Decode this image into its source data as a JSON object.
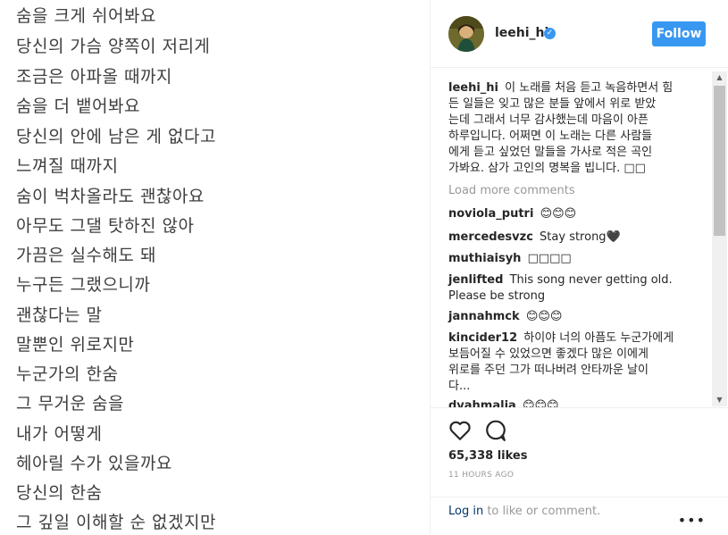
{
  "image": {
    "lyrics": [
      "숨을 크게 쉬어봐요",
      "당신의 가슴 양쪽이 저리게",
      "조금은 아파올 때까지",
      "숨을 더 뱉어봐요",
      "당신의 안에 남은 게 없다고",
      "느껴질 때까지",
      "숨이 벅차올라도 괜찮아요",
      "아무도 그댈 탓하진 않아",
      "가끔은 실수해도 돼",
      "누구든 그랬으니까",
      "괜찮다는 말",
      "말뿐인 위로지만",
      "누군가의 한숨",
      "그 무거운 숨을",
      "내가 어떻게",
      "헤아릴 수가 있을까요",
      "당신의 한숨",
      "그 깊일 이해할 순 없겠지만"
    ]
  },
  "header": {
    "username": "leehi_hi",
    "follow_label": "Follow",
    "colors": {
      "accent": "#3897f0"
    }
  },
  "caption": {
    "user": "leehi_hi",
    "lines": [
      "이 노래를 처음 듣고 녹음하면서 힘",
      "든 일들은 잊고 많은 분들 앞에서 위로 받았",
      "는데 그래서 너무 감사했는데 마음이 아픈",
      "하루입니다. 어쩌면 이 노래는 다른 사람들",
      "에게 듣고 싶었던 말들을 가사로 적은 곡인",
      "가봐요. 삼가 고인의 명복을 빕니다. □□"
    ]
  },
  "load_more": "Load more comments",
  "comments": [
    {
      "user": "noviola_putri",
      "text": "😊😊😊"
    },
    {
      "user": "mercedesvzc",
      "text": "Stay strong🖤"
    },
    {
      "user": "muthiaisyh",
      "text": "□□□□"
    },
    {
      "user": "jenlifted",
      "text": "This song never getting old.",
      "text2": "Please be strong"
    },
    {
      "user": "jannahmck",
      "text": "😊😊😊"
    },
    {
      "user": "kincider12",
      "text": "하이야 너의 아픔도 누군가에게",
      "text2": "보듬어질 수 있었으면 좋겠다 많은 이에게",
      "text3": "위로를 주던 그가 떠나버려 안타까운 날이",
      "text4": "다..."
    },
    {
      "user": "dyahmalia",
      "text": "😊😊😊"
    }
  ],
  "actions": {
    "likes": "65,338 likes",
    "time": "11 HOURS AGO"
  },
  "footer": {
    "login": "Log in",
    "rest": " to like or comment."
  }
}
